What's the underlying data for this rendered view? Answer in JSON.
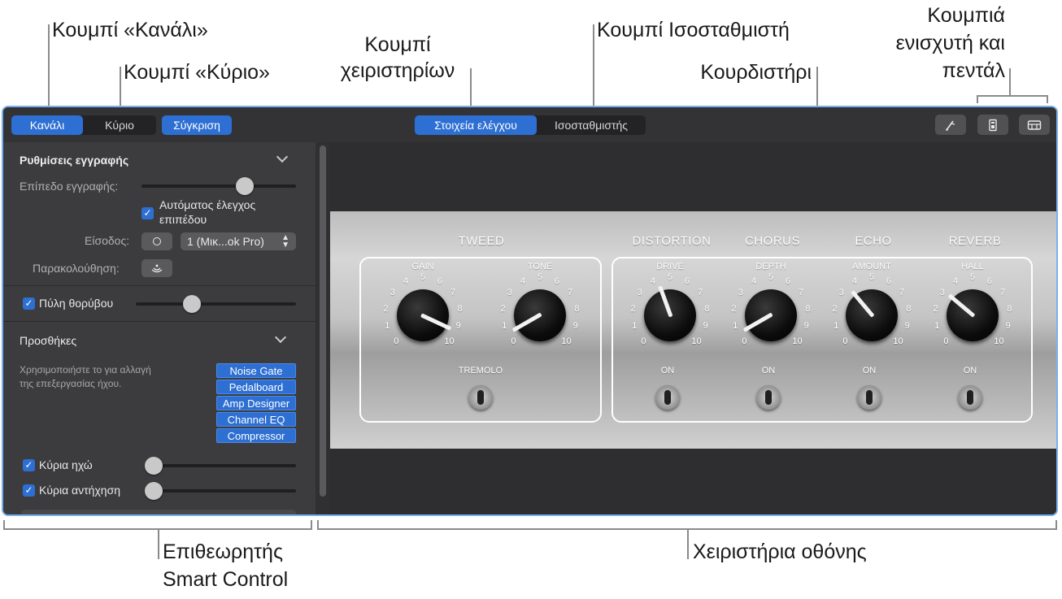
{
  "callouts": {
    "channel_button": "Κουμπί «Κανάλι»",
    "master_button": "Κουμπί «Κύριο»",
    "controls_button_line1": "Κουμπί",
    "controls_button_line2": "χειριστηρίων",
    "eq_button": "Κουμπί Ισοσταθμιστή",
    "tuner": "Κουρδιστήρι",
    "amp_pedal_line1": "Κουμπιά",
    "amp_pedal_line2": "ενισχυτή και",
    "amp_pedal_line3": "πεντάλ",
    "inspector_line1": "Επιθεωρητής",
    "inspector_line2": "Smart Control",
    "screen_controls": "Χειριστήρια οθόνης"
  },
  "toolbar": {
    "channel": "Κανάλι",
    "master": "Κύριο",
    "compare": "Σύγκριση",
    "controls": "Στοιχεία ελέγχου",
    "eq": "Ισοσταθμιστής",
    "icons": [
      "tuner-icon",
      "amp-icon",
      "pedalboard-icon"
    ]
  },
  "inspector": {
    "recording_settings": "Ρυθμίσεις εγγραφής",
    "recording_level": "Επίπεδο εγγραφής:",
    "auto_level_line1": "Αυτόματος έλεγχος",
    "auto_level_line2": "επιπέδου",
    "input_label": "Είσοδος:",
    "input_value": "1 (Μικ...ok Pro)",
    "monitoring_label": "Παρακολούθηση:",
    "noise_gate": "Πύλη θορύβου",
    "plugins_title": "Προσθήκες",
    "plugins_hint_line1": "Χρησιμοποιήστε το για αλλαγή",
    "plugins_hint_line2": "της επεξεργασίας ήχου.",
    "plugins": [
      "Noise Gate",
      "Pedalboard",
      "Amp Designer",
      "Channel EQ",
      "Compressor"
    ],
    "master_echo": "Κύρια ηχώ",
    "master_reverb": "Κύρια αντήχηση"
  },
  "amp": {
    "tweed": "TWEED",
    "distortion": "DISTORTION",
    "chorus": "CHORUS",
    "echo": "ECHO",
    "reverb": "REVERB",
    "knobs": {
      "gain": "GAIN",
      "tone": "TONE",
      "drive": "DRIVE",
      "depth": "DEPTH",
      "amount": "AMOUNT",
      "hall": "HALL"
    },
    "tremolo": "TREMOLO",
    "on": "ON",
    "scale": [
      "0",
      "1",
      "2",
      "3",
      "4",
      "5",
      "6",
      "7",
      "8",
      "9",
      "10"
    ]
  }
}
